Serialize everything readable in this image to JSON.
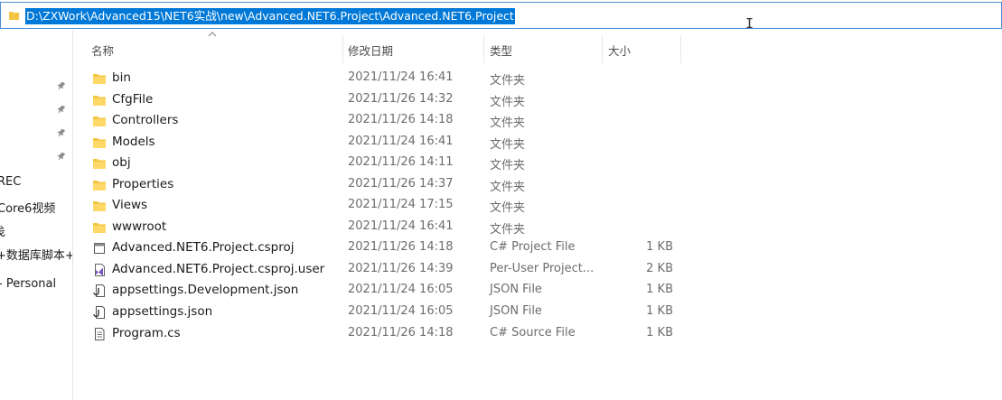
{
  "address_bar": {
    "path": "D:\\ZXWork\\Advanced15\\NET6实战\\new\\Advanced.NET6.Project\\Advanced.NET6.Project"
  },
  "nav": {
    "items": [
      {
        "label": "REC"
      },
      {
        "label": "Core6视频"
      },
      {
        "label": "戋"
      },
      {
        "label": "+数据库脚本+"
      },
      {
        "label": "- Personal"
      }
    ]
  },
  "columns": {
    "name": "名称",
    "date": "修改日期",
    "type": "类型",
    "size": "大小"
  },
  "files": [
    {
      "name": "bin",
      "date": "2021/11/24 16:41",
      "type": "文件夹",
      "size": "",
      "icon": "folder-icon"
    },
    {
      "name": "CfgFile",
      "date": "2021/11/26 14:32",
      "type": "文件夹",
      "size": "",
      "icon": "folder-icon"
    },
    {
      "name": "Controllers",
      "date": "2021/11/26 14:18",
      "type": "文件夹",
      "size": "",
      "icon": "folder-icon"
    },
    {
      "name": "Models",
      "date": "2021/11/24 16:41",
      "type": "文件夹",
      "size": "",
      "icon": "folder-icon"
    },
    {
      "name": "obj",
      "date": "2021/11/26 14:11",
      "type": "文件夹",
      "size": "",
      "icon": "folder-icon"
    },
    {
      "name": "Properties",
      "date": "2021/11/26 14:37",
      "type": "文件夹",
      "size": "",
      "icon": "folder-icon"
    },
    {
      "name": "Views",
      "date": "2021/11/24 17:15",
      "type": "文件夹",
      "size": "",
      "icon": "folder-icon"
    },
    {
      "name": "wwwroot",
      "date": "2021/11/24 16:41",
      "type": "文件夹",
      "size": "",
      "icon": "folder-icon"
    },
    {
      "name": "Advanced.NET6.Project.csproj",
      "date": "2021/11/26 14:18",
      "type": "C# Project File",
      "size": "1 KB",
      "icon": "csproj-file-icon"
    },
    {
      "name": "Advanced.NET6.Project.csproj.user",
      "date": "2021/11/26 14:39",
      "type": "Per-User Project...",
      "size": "2 KB",
      "icon": "visual-studio-file-icon"
    },
    {
      "name": "appsettings.Development.json",
      "date": "2021/11/24 16:05",
      "type": "JSON File",
      "size": "1 KB",
      "icon": "json-file-icon"
    },
    {
      "name": "appsettings.json",
      "date": "2021/11/24 16:05",
      "type": "JSON File",
      "size": "1 KB",
      "icon": "json-file-icon"
    },
    {
      "name": "Program.cs",
      "date": "2021/11/26 14:18",
      "type": "C# Source File",
      "size": "1 KB",
      "icon": "cs-file-icon"
    }
  ],
  "colors": {
    "selection": "#0078d7",
    "folder": "#f4c542",
    "address_border": "#4a90d9"
  }
}
